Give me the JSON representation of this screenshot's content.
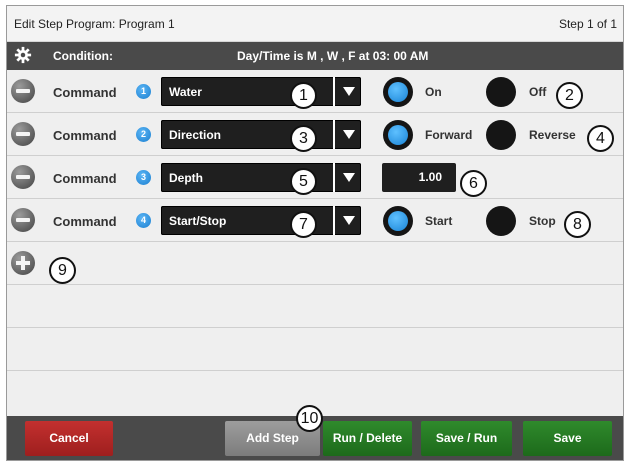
{
  "header": {
    "title": "Edit Step Program:  Program 1",
    "step_indicator": "Step 1 of 1"
  },
  "condition": {
    "label": "Condition:",
    "value": "Day/Time is  M , W , F at 03: 00 AM",
    "icon": "gear-icon"
  },
  "commands": [
    {
      "label": "Command",
      "number": "1",
      "select": "Water",
      "option_a": "On",
      "option_b": "Off",
      "selected": "a"
    },
    {
      "label": "Command",
      "number": "2",
      "select": "Direction",
      "option_a": "Forward",
      "option_b": "Reverse",
      "selected": "a"
    },
    {
      "label": "Command",
      "number": "3",
      "select": "Depth",
      "value": "1.00"
    },
    {
      "label": "Command",
      "number": "4",
      "select": "Start/Stop",
      "option_a": "Start",
      "option_b": "Stop",
      "selected": "a"
    }
  ],
  "callouts": [
    "1",
    "2",
    "3",
    "4",
    "5",
    "6",
    "7",
    "8",
    "9",
    "10"
  ],
  "footer": {
    "cancel": "Cancel",
    "add_step": "Add Step",
    "run_delete": "Run / Delete",
    "save_run": "Save / Run",
    "save": "Save"
  },
  "colors": {
    "accent_blue": "#1a84d6",
    "cancel_red": "#b02827",
    "action_green": "#267a23",
    "bar_dark": "#4a4a4a"
  }
}
